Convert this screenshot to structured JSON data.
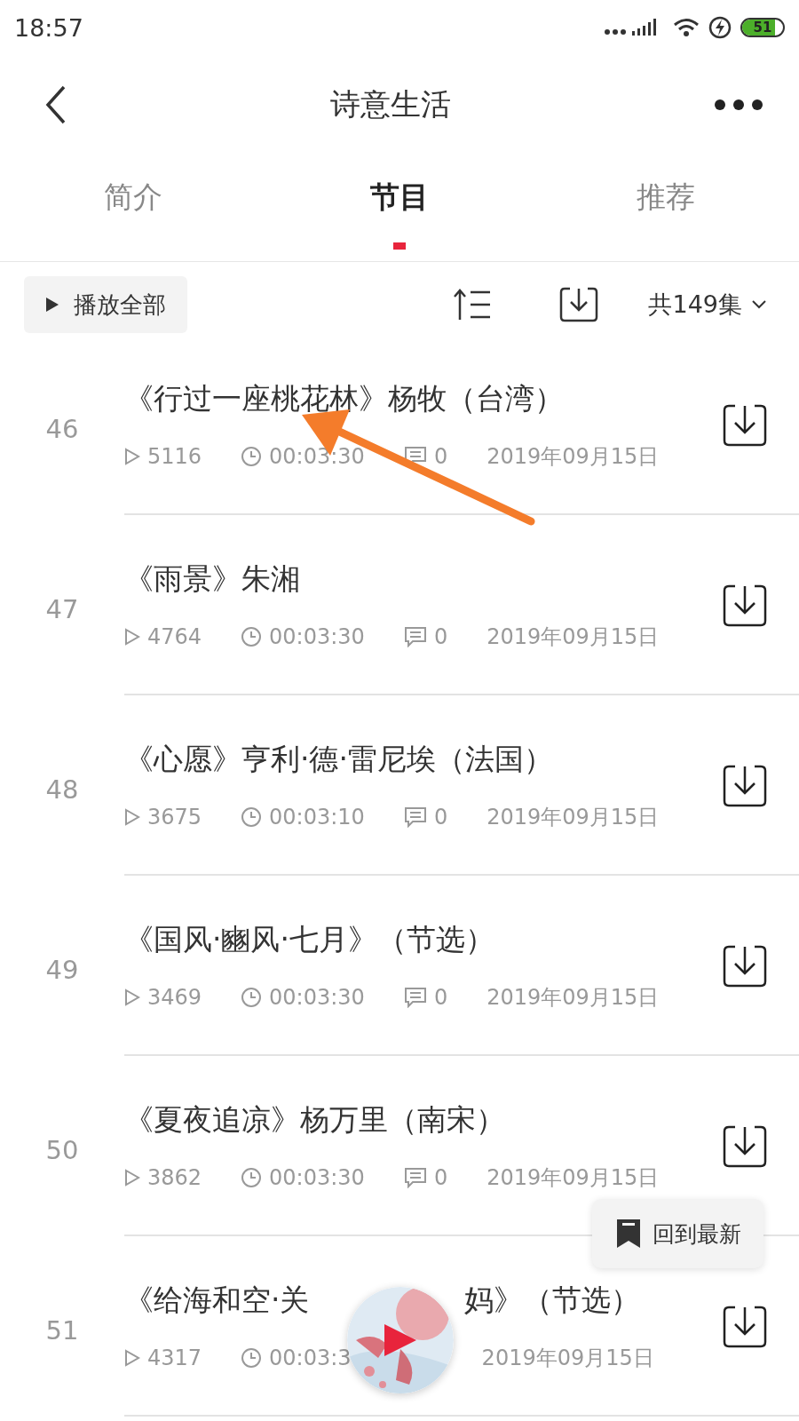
{
  "status_bar": {
    "time": "18:57",
    "battery": "51"
  },
  "header": {
    "title": "诗意生活"
  },
  "tabs": [
    {
      "label": "简介",
      "selected": false
    },
    {
      "label": "节目",
      "selected": true
    },
    {
      "label": "推荐",
      "selected": false
    }
  ],
  "toolbar": {
    "play_all": "播放全部",
    "count": "共149集"
  },
  "episodes": [
    {
      "index": "46",
      "title": "《行过一座桃花林》杨牧（台湾）",
      "plays": "5116",
      "duration": "00:03:30",
      "comments": "0",
      "date": "2019年09月15日"
    },
    {
      "index": "47",
      "title": "《雨景》朱湘",
      "plays": "4764",
      "duration": "00:03:30",
      "comments": "0",
      "date": "2019年09月15日"
    },
    {
      "index": "48",
      "title": "《心愿》亨利·德·雷尼埃（法国）",
      "plays": "3675",
      "duration": "00:03:10",
      "comments": "0",
      "date": "2019年09月15日"
    },
    {
      "index": "49",
      "title": "《国风·豳风·七月》（节选）",
      "plays": "3469",
      "duration": "00:03:30",
      "comments": "0",
      "date": "2019年09月15日"
    },
    {
      "index": "50",
      "title": "《夏夜追凉》杨万里（南宋）",
      "plays": "3862",
      "duration": "00:03:30",
      "comments": "0",
      "date": "2019年09月15日"
    },
    {
      "index": "51",
      "title": "《给海和空·关",
      "title_tail": "妈》（节选）",
      "plays": "4317",
      "duration": "00:03:3",
      "date": "2019年09月15日"
    }
  ],
  "back_to_latest": "回到最新"
}
